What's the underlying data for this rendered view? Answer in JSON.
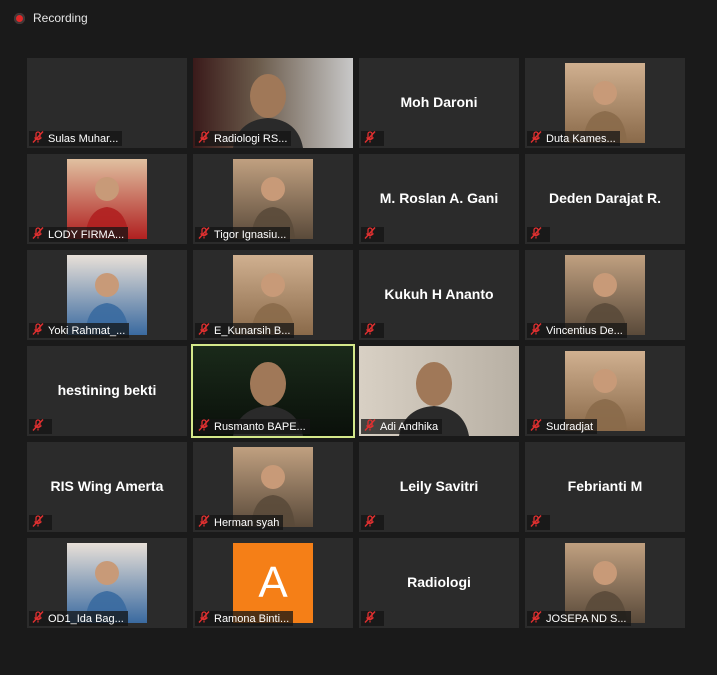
{
  "window": {
    "recording_label": "Recording"
  },
  "colors": {
    "active_border": "#d4e88a",
    "muted_icon": "#e03030",
    "tile_bg": "#2b2b2b",
    "avatar_bg": "#f57f17"
  },
  "participants": [
    {
      "label": "Sulas Muhar...",
      "display": "blank"
    },
    {
      "label": "Radiologi RS...",
      "display": "video"
    },
    {
      "label": "",
      "display": "name",
      "big_name": "Moh Daroni"
    },
    {
      "label": "Duta Kames...",
      "display": "photo"
    },
    {
      "label": "LODY FIRMA...",
      "display": "photo"
    },
    {
      "label": "Tigor Ignasiu...",
      "display": "photo"
    },
    {
      "label": "",
      "display": "name",
      "big_name": "M. Roslan A. Gani"
    },
    {
      "label": "",
      "display": "name",
      "big_name": "Deden Darajat R."
    },
    {
      "label": "Yoki Rahmat_...",
      "display": "photo"
    },
    {
      "label": "E_Kunarsih B...",
      "display": "photo"
    },
    {
      "label": "",
      "display": "name",
      "big_name": "Kukuh H Ananto"
    },
    {
      "label": "Vincentius De...",
      "display": "photo"
    },
    {
      "label": "",
      "display": "name",
      "big_name": "hestining bekti"
    },
    {
      "label": "Rusmanto BAPE...",
      "display": "video",
      "active": true
    },
    {
      "label": "Adi Andhika",
      "display": "video"
    },
    {
      "label": "Sudradjat",
      "display": "photo"
    },
    {
      "label": "",
      "display": "name",
      "big_name": "RIS Wing Amerta"
    },
    {
      "label": "Herman syah",
      "display": "photo"
    },
    {
      "label": "",
      "display": "name",
      "big_name": "Leily Savitri"
    },
    {
      "label": "",
      "display": "name",
      "big_name": "Febrianti M"
    },
    {
      "label": "OD1_Ida Bag...",
      "display": "photo"
    },
    {
      "label": "Ramona Binti...",
      "display": "avatar",
      "avatar_letter": "A"
    },
    {
      "label": "",
      "display": "name",
      "big_name": "Radiologi"
    },
    {
      "label": "JOSEPA ND S...",
      "display": "photo"
    }
  ]
}
